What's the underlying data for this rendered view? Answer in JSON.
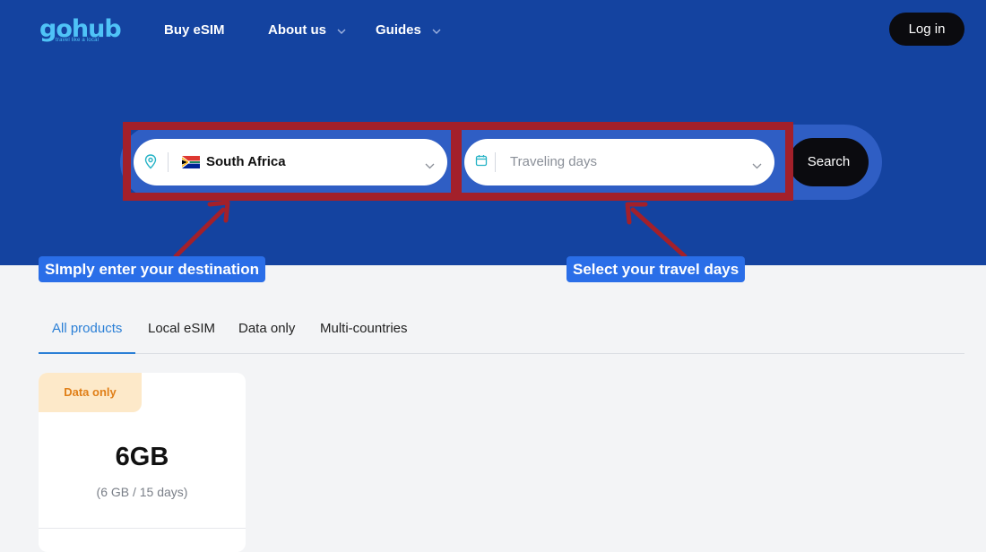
{
  "header": {
    "logo": {
      "word": "gohub",
      "tagline": "travel like a local"
    },
    "nav": [
      {
        "label": "Buy eSIM",
        "has_dropdown": false
      },
      {
        "label": "About us",
        "has_dropdown": true
      },
      {
        "label": "Guides",
        "has_dropdown": true
      }
    ],
    "login_label": "Log in"
  },
  "search": {
    "destination": {
      "icon": "location-pin-icon",
      "flag": "south-africa-flag",
      "value": "South Africa"
    },
    "travel_days": {
      "icon": "calendar-icon",
      "placeholder": "Traveling days"
    },
    "button_label": "Search"
  },
  "annotations": {
    "destination_callout": "SImply enter your destination",
    "days_callout": "Select your travel days",
    "highlight_color": "#a3202a",
    "callout_color": "#2a6ee8"
  },
  "tabs": [
    {
      "label": "All products",
      "active": true
    },
    {
      "label": "Local eSIM",
      "active": false
    },
    {
      "label": "Data only",
      "active": false
    },
    {
      "label": "Multi-countries",
      "active": false
    }
  ],
  "products": [
    {
      "badge": "Data only",
      "amount": "6GB",
      "detail": "(6 GB / 15 days)"
    }
  ],
  "colors": {
    "hero_background": "#1443a0",
    "accent": "#4fc3f7",
    "active_tab": "#2a7fd6",
    "badge_bg": "#fde9c9",
    "badge_text": "#e07f18"
  }
}
